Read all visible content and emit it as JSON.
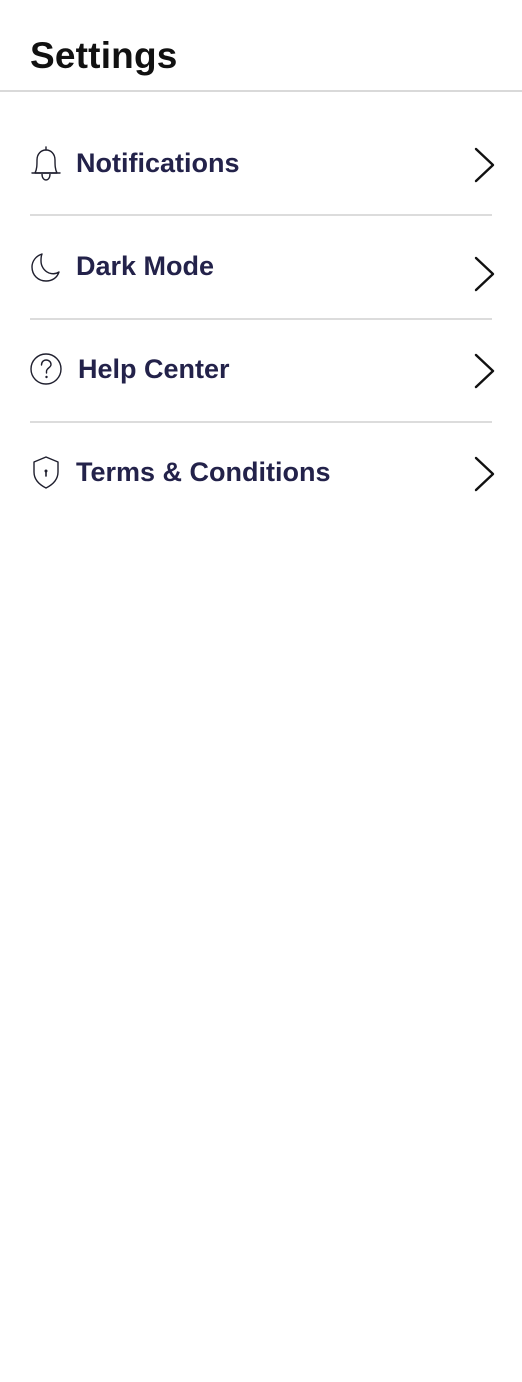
{
  "header": {
    "title": "Settings"
  },
  "settings": {
    "items": [
      {
        "label": "Notifications",
        "icon": "bell-icon"
      },
      {
        "label": "Dark Mode",
        "icon": "moon-icon"
      },
      {
        "label": "Help Center",
        "icon": "question-circle-icon"
      },
      {
        "label": "Terms & Conditions",
        "icon": "shield-icon"
      }
    ]
  },
  "colors": {
    "label": "#23224a",
    "title": "#111111",
    "divider": "#dcdcdc",
    "background": "#ffffff"
  }
}
